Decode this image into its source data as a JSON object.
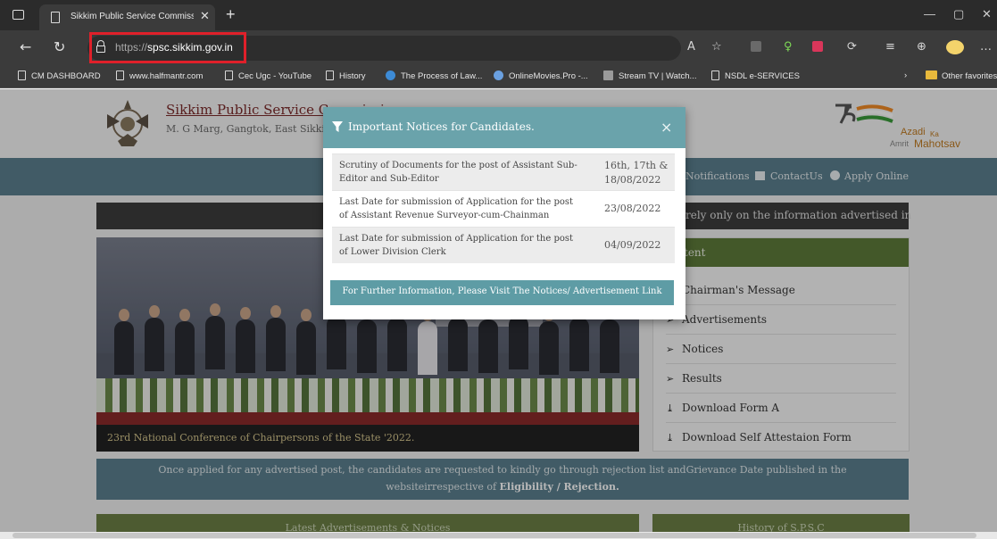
{
  "browser": {
    "tab_title": "Sikkim Public Service Commission",
    "url_protocol": "https://",
    "url_host": "spsc.sikkim.gov.in",
    "bookmarks": [
      {
        "label": "CM DASHBOARD"
      },
      {
        "label": "www.halfmantr.com"
      },
      {
        "label": "Cec Ugc - YouTube"
      },
      {
        "label": "History"
      },
      {
        "label": "The Process of Law..."
      },
      {
        "label": "OnlineMovies.Pro -..."
      },
      {
        "label": "Stream TV | Watch..."
      },
      {
        "label": "NSDL e-SERVICES"
      }
    ],
    "other_favorites": "Other favorites"
  },
  "site": {
    "title": "Sikkim Public Service Commission",
    "address": "M. G Marg, Gangtok, East Sikkim",
    "azadi": {
      "line1": "Azadi",
      "line2": "Ka",
      "line3": "Amrit",
      "line4": "Mahotsav",
      "number": "75"
    },
    "nav": {
      "notifications": "Notifications",
      "contact": "ContactUs",
      "apply": "Apply Online"
    },
    "ticker": "rely only on the information advertised in",
    "photo_caption": "23rd National Conference of Chairpersons of the State '2022.",
    "side_heading": "tent",
    "side_items": [
      {
        "label": "Chairman's Message"
      },
      {
        "label": "Advertisements"
      },
      {
        "label": "Notices"
      },
      {
        "label": "Results"
      },
      {
        "label": "Download Form A"
      },
      {
        "label": "Download Self Attestaion Form"
      }
    ],
    "notice_line1": "Once applied for any advertised post, the candidates are requested to kindly go through rejection list andGrievance Date published in the",
    "notice_line2_prefix": "websiteirrespective of",
    "notice_line2_bold": "Eligibility / Rejection.",
    "bottom_left": "Latest Advertisements & Notices",
    "bottom_right": "History of S.P.S.C"
  },
  "modal": {
    "title": "Important Notices for Candidates.",
    "close": "×",
    "rows": [
      {
        "left1": "Scrutiny of Documents for the post of Assistant Sub-",
        "left2": "Editor and Sub-Editor",
        "right1": "16th, 17th &",
        "right2": "18/08/2022"
      },
      {
        "left1": "Last Date for submission of Application for the post",
        "left2": "of Assistant Revenue Surveyor-cum-Chainman",
        "right1": "23/08/2022",
        "right2": ""
      },
      {
        "left1": "Last Date for submission of Application for the post",
        "left2": "of Lower Division Clerk",
        "right1": "04/09/2022",
        "right2": ""
      }
    ],
    "button": "For Further Information, Please Visit The Notices/ Advertisement Link"
  }
}
